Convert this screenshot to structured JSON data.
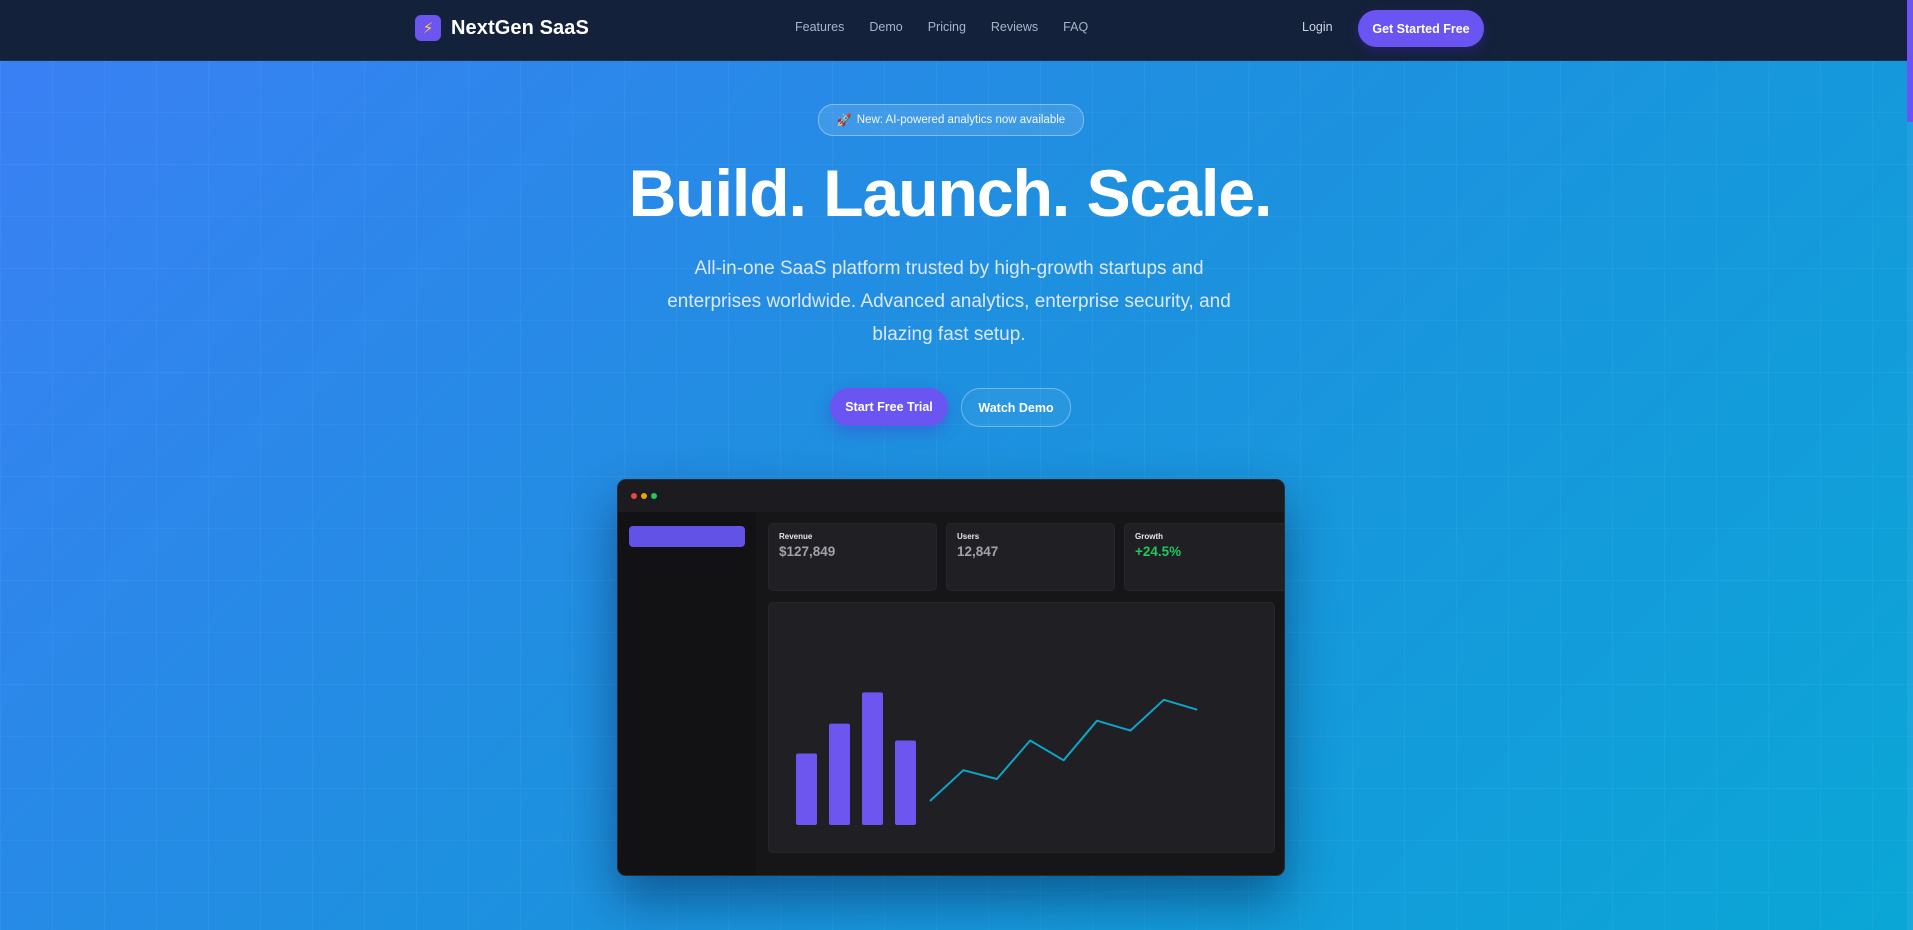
{
  "brand": {
    "name": "NextGen SaaS",
    "logo_icon": "⚡"
  },
  "nav": {
    "links": [
      "Features",
      "Demo",
      "Pricing",
      "Reviews",
      "FAQ"
    ],
    "login": "Login",
    "cta": "Get Started Free"
  },
  "hero": {
    "badge_icon": "🚀",
    "badge_text": "New: AI-powered analytics now available",
    "title": "Build. Launch. Scale.",
    "subtitle": "All-in-one SaaS platform trusted by high-growth startups and enterprises worldwide. Advanced analytics, enterprise security, and blazing fast setup.",
    "primary_button": "Start Free Trial",
    "secondary_button": "Watch Demo"
  },
  "dashboard": {
    "stats": [
      {
        "label": "Revenue",
        "value": "$127,849"
      },
      {
        "label": "Users",
        "value": "12,847"
      },
      {
        "label": "Growth",
        "value": "+24.5%"
      }
    ]
  },
  "chart_data": {
    "type": "bar",
    "bars": {
      "values": [
        55,
        78,
        102,
        65
      ],
      "color": "#6d55f0"
    },
    "line": {
      "values": [
        0,
        28,
        20,
        55,
        37,
        73,
        64,
        92,
        83
      ],
      "color": "#0ea5c9"
    }
  },
  "colors": {
    "accent": "#6b55f2",
    "nav_bg": "#14213a",
    "positive": "#22c55e",
    "line": "#0ea5c9"
  }
}
